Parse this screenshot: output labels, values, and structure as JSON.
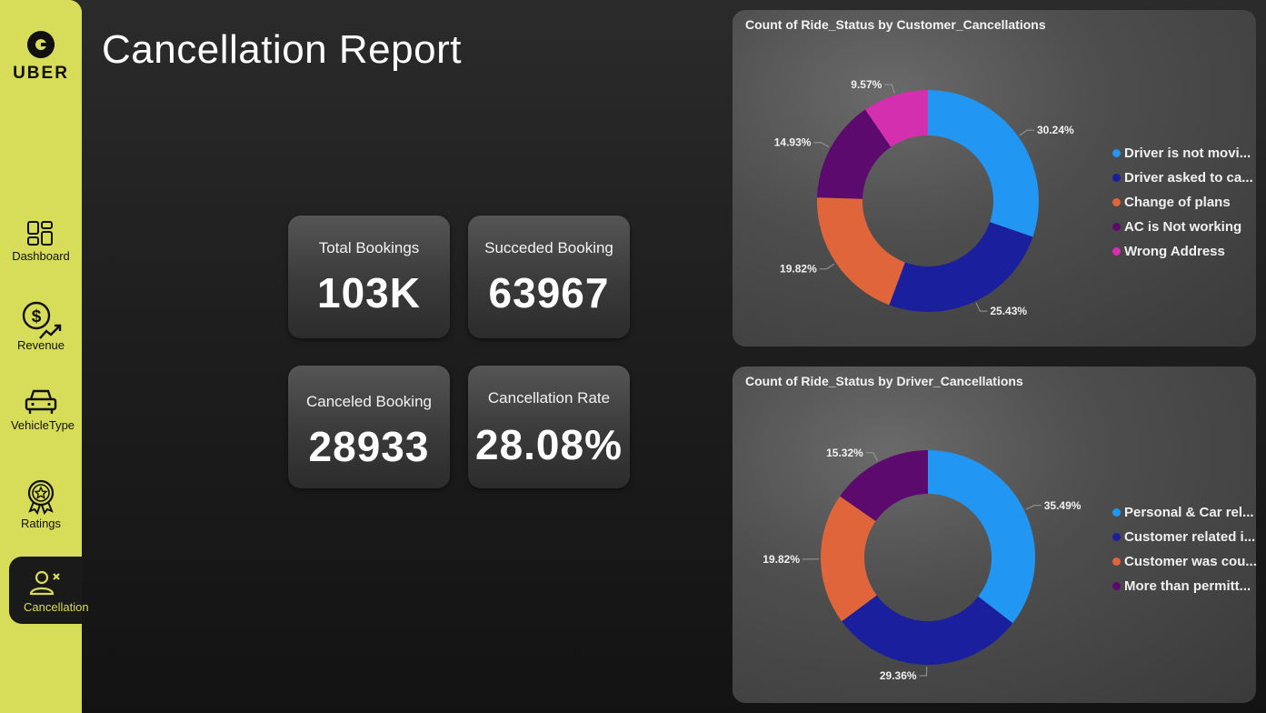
{
  "app": {
    "title": "Cancellation Report",
    "logo_text": "UBER"
  },
  "sidebar": {
    "items": [
      {
        "label": "Dashboard",
        "icon": "dashboard-icon"
      },
      {
        "label": "Revenue",
        "icon": "revenue-icon"
      },
      {
        "label": "VehicleType",
        "icon": "car-icon"
      },
      {
        "label": "Ratings",
        "icon": "award-icon"
      },
      {
        "label": "Cancellation",
        "icon": "user-x-icon",
        "active": true
      }
    ],
    "colors": {
      "background": "#d7dd58",
      "active_bg": "#1a1a1a",
      "active_text": "#d7dd58"
    }
  },
  "kpis": {
    "total_bookings": {
      "label": "Total Bookings",
      "value": "103K"
    },
    "succeded_booking": {
      "label": "Succeded Booking",
      "value": "63967"
    },
    "canceled_booking": {
      "label": "Canceled Booking",
      "value": "28933"
    },
    "cancellation_rate": {
      "label": "Cancellation Rate",
      "value": "28.08%"
    }
  },
  "chart_data": [
    {
      "type": "pie",
      "donut": true,
      "title": "Count of Ride_Status by Customer_Cancellations",
      "legend_position": "right",
      "categories": [
        "Driver is not movi...",
        "Driver asked to ca...",
        "Change of plans",
        "AC is Not working",
        "Wrong Address"
      ],
      "values": [
        30.24,
        25.43,
        19.82,
        14.93,
        9.57
      ],
      "labels": [
        "30.24%",
        "25.43%",
        "19.82%",
        "14.93%",
        "9.57%"
      ],
      "colors": [
        "#2196f3",
        "#1a1f9e",
        "#e0653a",
        "#5c0a6e",
        "#d42fae"
      ]
    },
    {
      "type": "pie",
      "donut": true,
      "title": "Count of Ride_Status by Driver_Cancellations",
      "legend_position": "right",
      "categories": [
        "Personal & Car rel...",
        "Customer related i...",
        "Customer was cou...",
        "More than permitt..."
      ],
      "values": [
        35.49,
        29.36,
        19.82,
        15.32
      ],
      "labels": [
        "35.49%",
        "29.36%",
        "19.82%",
        "15.32%"
      ],
      "colors": [
        "#2196f3",
        "#1a1f9e",
        "#e0653a",
        "#5c0a6e"
      ]
    }
  ]
}
